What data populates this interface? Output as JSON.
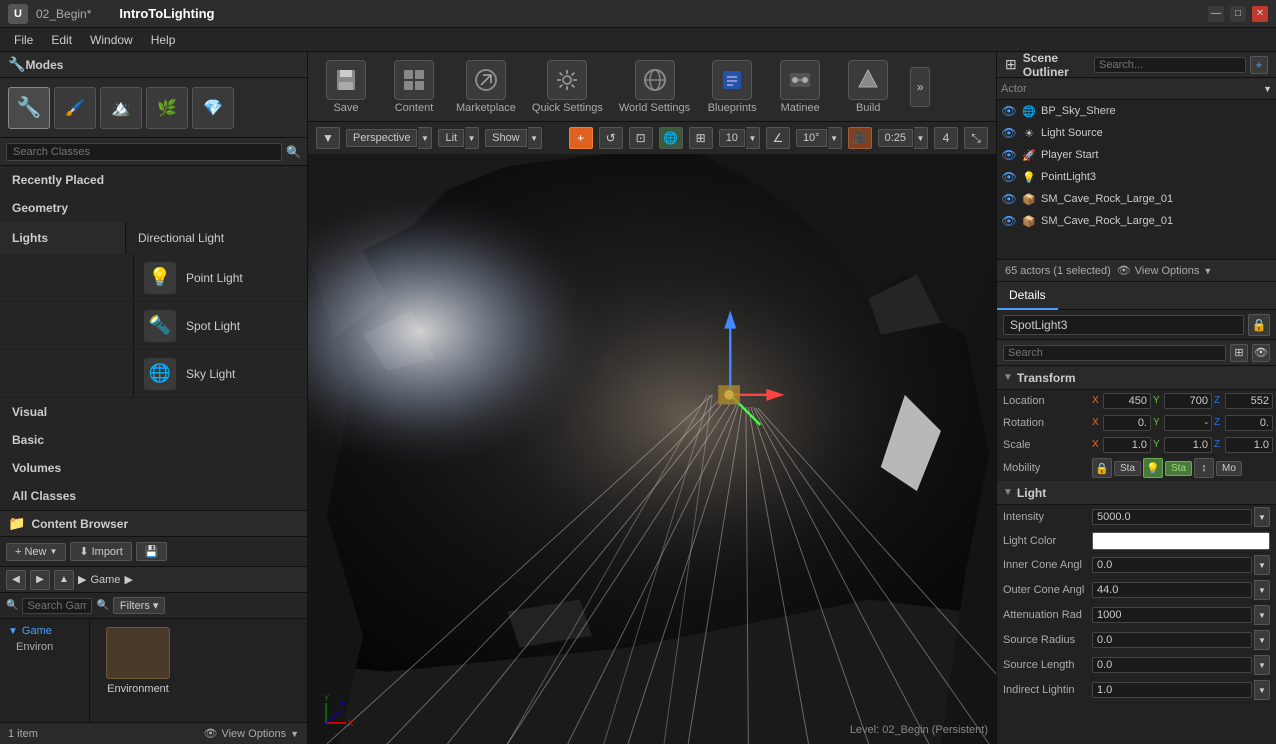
{
  "titlebar": {
    "logo": "UE",
    "file": "02_Begin*",
    "app": "IntroToLighting",
    "controls": [
      "—",
      "□",
      "✕"
    ]
  },
  "menubar": {
    "items": [
      "File",
      "Edit",
      "Window",
      "Help"
    ]
  },
  "modes": {
    "label": "Modes",
    "icons": [
      "🔧",
      "✏️",
      "🌿",
      "🎨",
      "💎"
    ]
  },
  "search_classes": {
    "placeholder": "Search Classes"
  },
  "categories": [
    {
      "id": "recently-placed",
      "label": "Recently Placed"
    },
    {
      "id": "geometry",
      "label": "Geometry"
    },
    {
      "id": "lights",
      "label": "Lights",
      "active": true
    },
    {
      "id": "visual",
      "label": "Visual"
    },
    {
      "id": "basic",
      "label": "Basic"
    },
    {
      "id": "volumes",
      "label": "Volumes"
    },
    {
      "id": "all-classes",
      "label": "All Classes"
    }
  ],
  "lights": [
    {
      "id": "directional",
      "icon": "☀",
      "label": "Directional Light"
    },
    {
      "id": "point",
      "icon": "💡",
      "label": "Point Light"
    },
    {
      "id": "spot",
      "icon": "🔦",
      "label": "Spot Light"
    },
    {
      "id": "sky",
      "icon": "🌐",
      "label": "Sky Light"
    }
  ],
  "toolbar": {
    "save_label": "Save",
    "content_label": "Content",
    "marketplace_label": "Marketplace",
    "quick_settings_label": "Quick Settings",
    "world_settings_label": "World Settings",
    "blueprints_label": "Blueprints",
    "matinee_label": "Matinee",
    "build_label": "Build"
  },
  "viewport": {
    "mode": "Perspective",
    "lit": "Lit",
    "show": "Show",
    "grid": "10",
    "angle": "10°",
    "time": "0:25",
    "cam": "4",
    "status": "Level: 02_Begin (Persistent)"
  },
  "scene_outliner": {
    "title": "Scene Outliner",
    "placeholder": "Search...",
    "columns": {
      "actor": "Actor"
    },
    "items": [
      {
        "id": "bp-sky",
        "eye": true,
        "icon": "🌐",
        "name": "BP_Sky_Shere"
      },
      {
        "id": "light-source",
        "eye": true,
        "icon": "☀",
        "name": "Light Source"
      },
      {
        "id": "player-start",
        "eye": true,
        "icon": "🚀",
        "name": "Player Start"
      },
      {
        "id": "pointlight3",
        "eye": true,
        "icon": "💡",
        "name": "PointLight3"
      },
      {
        "id": "sm-cave-1",
        "eye": true,
        "icon": "📦",
        "name": "SM_Cave_Rock_Large_01"
      },
      {
        "id": "sm-cave-2",
        "eye": true,
        "icon": "📦",
        "name": "SM_Cave_Rock_Large_01"
      }
    ],
    "footer": "65 actors (1 selected)",
    "view_options": "View Options"
  },
  "details": {
    "tab": "Details",
    "selected_name": "SpotLight3",
    "search_placeholder": "Search",
    "transform": {
      "title": "Transform",
      "location": {
        "label": "Location",
        "x": "450",
        "y": "700",
        "z": "552"
      },
      "rotation": {
        "label": "Rotation",
        "x": "0.",
        "y": "-",
        "z": "0."
      },
      "scale": {
        "label": "Scale",
        "x": "1.0",
        "y": "1.0",
        "z": "1.0"
      },
      "mobility": {
        "label": "Mobility",
        "buttons": [
          "Sta",
          "Sta",
          "Mo"
        ]
      }
    },
    "light": {
      "title": "Light",
      "intensity": {
        "label": "Intensity",
        "value": "5000.0"
      },
      "light_color": {
        "label": "Light Color"
      },
      "inner_cone_angle": {
        "label": "Inner Cone Angl",
        "value": "0.0"
      },
      "outer_cone_angle": {
        "label": "Outer Cone Angl",
        "value": "44.0"
      },
      "attenuation_radius": {
        "label": "Attenuation Rad",
        "value": "1000"
      },
      "source_radius": {
        "label": "Source Radius",
        "value": "0.0"
      },
      "source_length": {
        "label": "Source Length",
        "value": "0.0"
      },
      "indirect_lighting": {
        "label": "Indirect Lightin",
        "value": "1.0"
      }
    }
  },
  "content_browser": {
    "title": "Content Browser",
    "new_label": "New",
    "import_label": "Import",
    "path": "Game",
    "tree_items": [
      "Game",
      "Environ"
    ],
    "folders": [
      {
        "name": "Environment"
      }
    ],
    "item_count": "1 item",
    "view_options": "View Options",
    "search_placeholder": "Search Game",
    "filter_label": "Filters ▾"
  }
}
